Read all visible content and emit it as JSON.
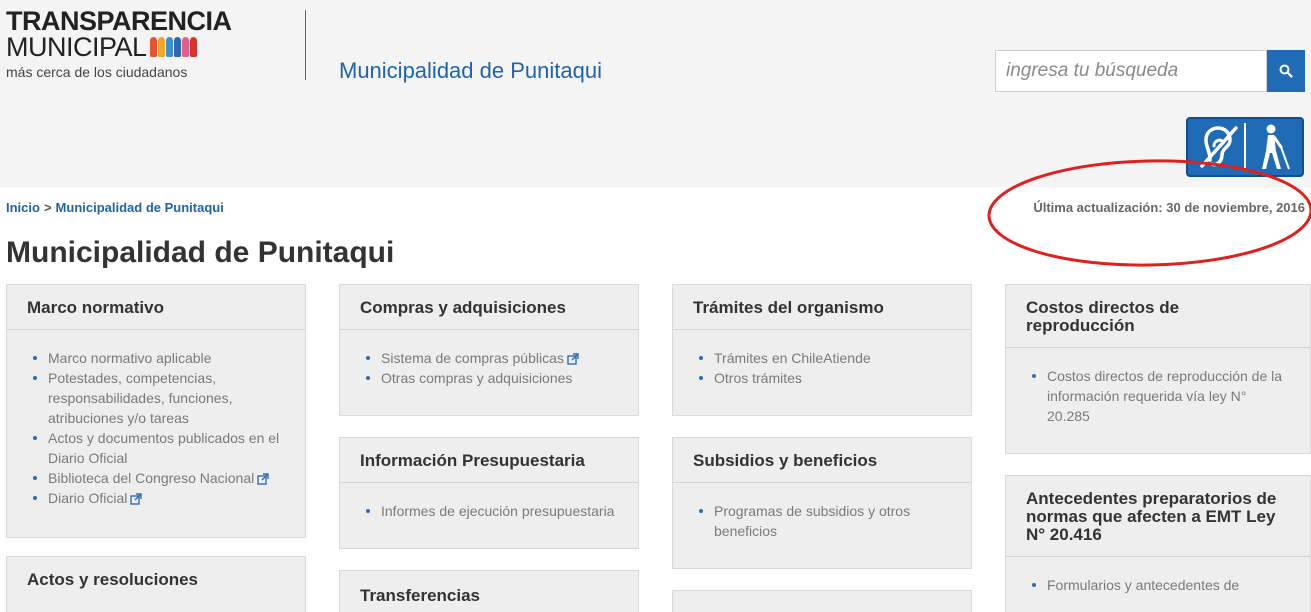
{
  "header": {
    "logo_line1": "TRANSPARENCIA",
    "logo_line2": "MUNICIPAL",
    "logo_tagline": "más cerca de los ciudadanos",
    "site_name": "Municipalidad de Punitaqui",
    "search_placeholder": "ingresa tu búsqueda"
  },
  "breadcrumb": {
    "home": "Inicio",
    "separator": ">",
    "current": "Municipalidad de Punitaqui"
  },
  "updated": "Última actualización: 30 de noviembre, 2016",
  "page_title": "Municipalidad de Punitaqui",
  "colors": {
    "brand_blue": "#1f6bb5",
    "link_blue": "#1f64a8",
    "annotation_red": "#e0201c"
  },
  "cards": {
    "marco": {
      "title": "Marco normativo",
      "items": [
        "Marco normativo aplicable",
        "Potestades, competencias, responsabilidades, funciones, atribuciones y/o tareas",
        "Actos y documentos publicados en el Diario Oficial",
        "Biblioteca del Congreso Nacional",
        "Diario Oficial"
      ]
    },
    "actos": {
      "title": "Actos y resoluciones"
    },
    "compras": {
      "title": "Compras y adquisiciones",
      "items": [
        "Sistema de compras públicas",
        "Otras compras y adquisiciones"
      ]
    },
    "presupuesto": {
      "title": "Información Presupuestaria",
      "items": [
        "Informes de ejecución presupuestaria"
      ]
    },
    "transferencias": {
      "title": "Transferencias"
    },
    "tramites": {
      "title": "Trámites del organismo",
      "items": [
        "Trámites en ChileAtiende",
        "Otros trámites"
      ]
    },
    "subsidios": {
      "title": "Subsidios y beneficios",
      "items": [
        "Programas de subsidios y otros beneficios"
      ]
    },
    "costos": {
      "title": "Costos directos de reproducción",
      "items": [
        "Costos directos de reproducción de la información requerida vía ley N° 20.285"
      ]
    },
    "antecedentes": {
      "title": "Antecedentes preparatorios de normas que afecten a EMT Ley N° 20.416",
      "items": [
        "Formularios y antecedentes de"
      ]
    }
  },
  "icons": {
    "search": "search-icon",
    "hearing": "hearing-impaired-icon",
    "visual": "blind-person-icon",
    "external": "external-link-icon"
  }
}
